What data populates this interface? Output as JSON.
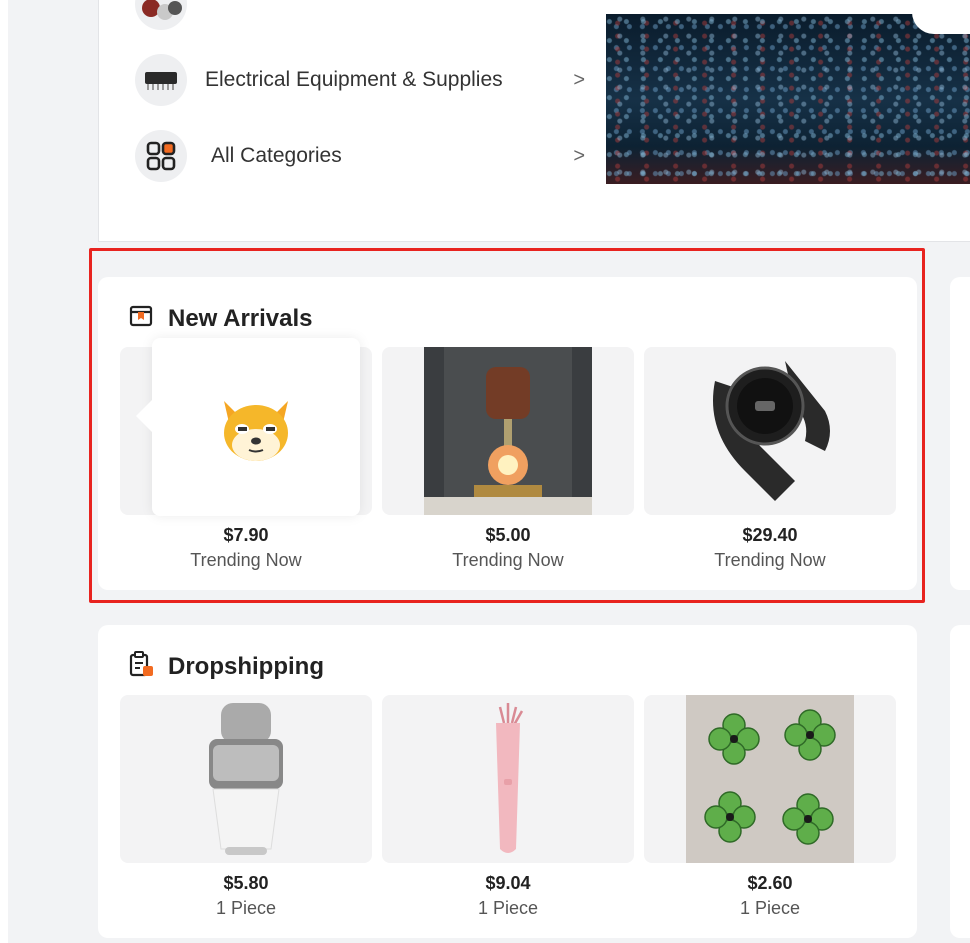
{
  "categories": {
    "items": [
      {
        "label": "Electrical Equipment & Supplies",
        "chevron": ">",
        "icon": "chip-icon"
      },
      {
        "label": "All Categories",
        "chevron": ">",
        "icon": "grid-icon"
      }
    ]
  },
  "sections": {
    "new_arrivals": {
      "title": "New Arrivals",
      "icon": "box-icon",
      "products": [
        {
          "price": "$7.90",
          "subtitle": "Trending Now",
          "image": "doge-emoji"
        },
        {
          "price": "$5.00",
          "subtitle": "Trending Now",
          "image": "siphon-coffee-maker"
        },
        {
          "price": "$29.40",
          "subtitle": "Trending Now",
          "image": "smart-watch"
        }
      ]
    },
    "dropshipping": {
      "title": "Dropshipping",
      "icon": "clipboard-icon",
      "products": [
        {
          "price": "$5.80",
          "subtitle": "1 Piece",
          "image": "coffee-grinder"
        },
        {
          "price": "$9.04",
          "subtitle": "1 Piece",
          "image": "pink-brush"
        },
        {
          "price": "$2.60",
          "subtitle": "1 Piece",
          "image": "clover-magnets"
        }
      ]
    }
  },
  "colors": {
    "accent": "#e8231f",
    "icon_orange": "#f26b21",
    "background": "#f2f3f5"
  }
}
